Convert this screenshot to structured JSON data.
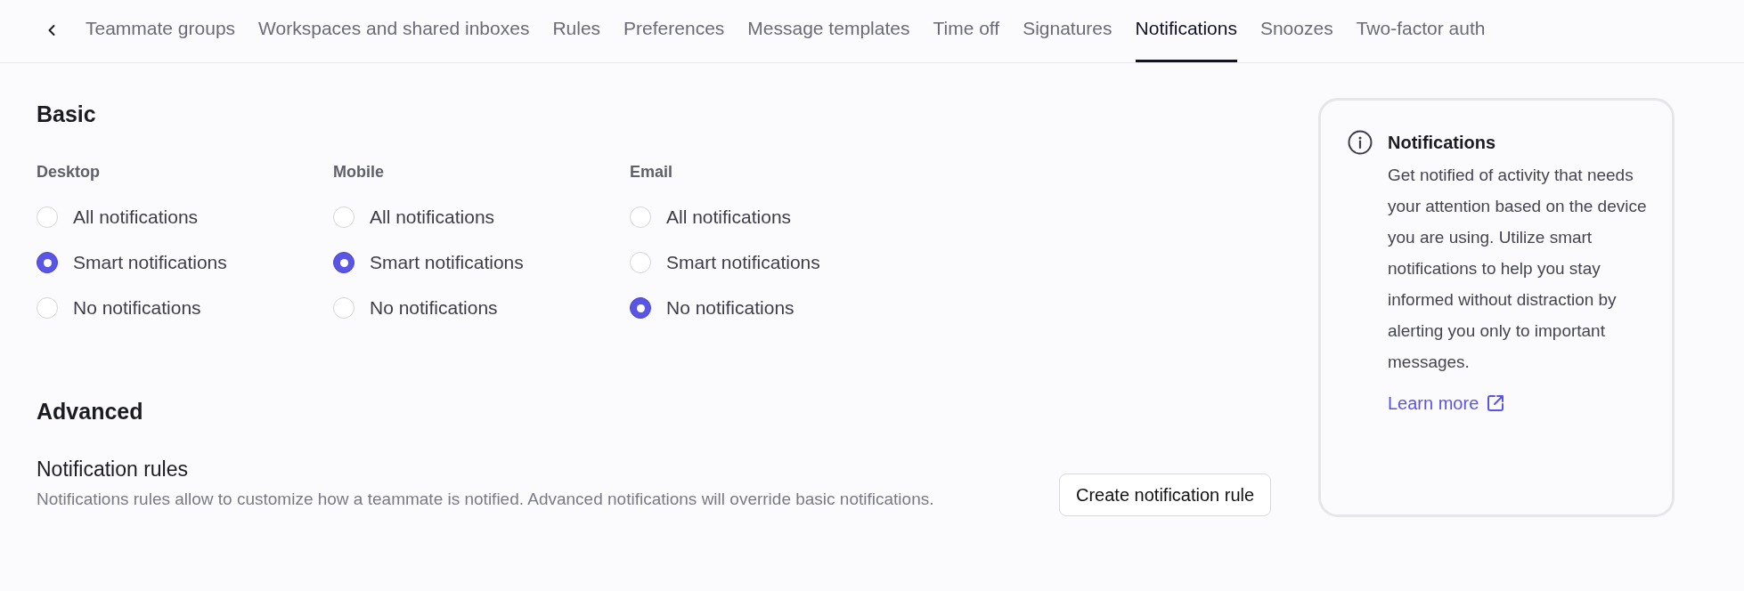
{
  "tabs": [
    {
      "label": "Teammate groups",
      "selected": false
    },
    {
      "label": "Workspaces and shared inboxes",
      "selected": false
    },
    {
      "label": "Rules",
      "selected": false
    },
    {
      "label": "Preferences",
      "selected": false
    },
    {
      "label": "Message templates",
      "selected": false
    },
    {
      "label": "Time off",
      "selected": false
    },
    {
      "label": "Signatures",
      "selected": false
    },
    {
      "label": "Notifications",
      "selected": true
    },
    {
      "label": "Snoozes",
      "selected": false
    },
    {
      "label": "Two-factor auth",
      "selected": false
    }
  ],
  "basic": {
    "title": "Basic",
    "groups": [
      {
        "label": "Desktop",
        "options": [
          {
            "label": "All notifications",
            "selected": false
          },
          {
            "label": "Smart notifications",
            "selected": true
          },
          {
            "label": "No notifications",
            "selected": false
          }
        ]
      },
      {
        "label": "Mobile",
        "options": [
          {
            "label": "All notifications",
            "selected": false
          },
          {
            "label": "Smart notifications",
            "selected": true
          },
          {
            "label": "No notifications",
            "selected": false
          }
        ]
      },
      {
        "label": "Email",
        "options": [
          {
            "label": "All notifications",
            "selected": false
          },
          {
            "label": "Smart notifications",
            "selected": false
          },
          {
            "label": "No notifications",
            "selected": true
          }
        ]
      }
    ]
  },
  "advanced": {
    "title": "Advanced",
    "rules_title": "Notification rules",
    "rules_description": "Notifications rules allow to customize how a teammate is notified. Advanced notifications will override basic notifications.",
    "button": "Create notification rule"
  },
  "info_card": {
    "title": "Notifications",
    "body": "Get notified of activity that needs your attention based on the device you are using. Utilize smart notifications to help you stay informed without distraction by alerting you only to important messages.",
    "link": "Learn more"
  }
}
